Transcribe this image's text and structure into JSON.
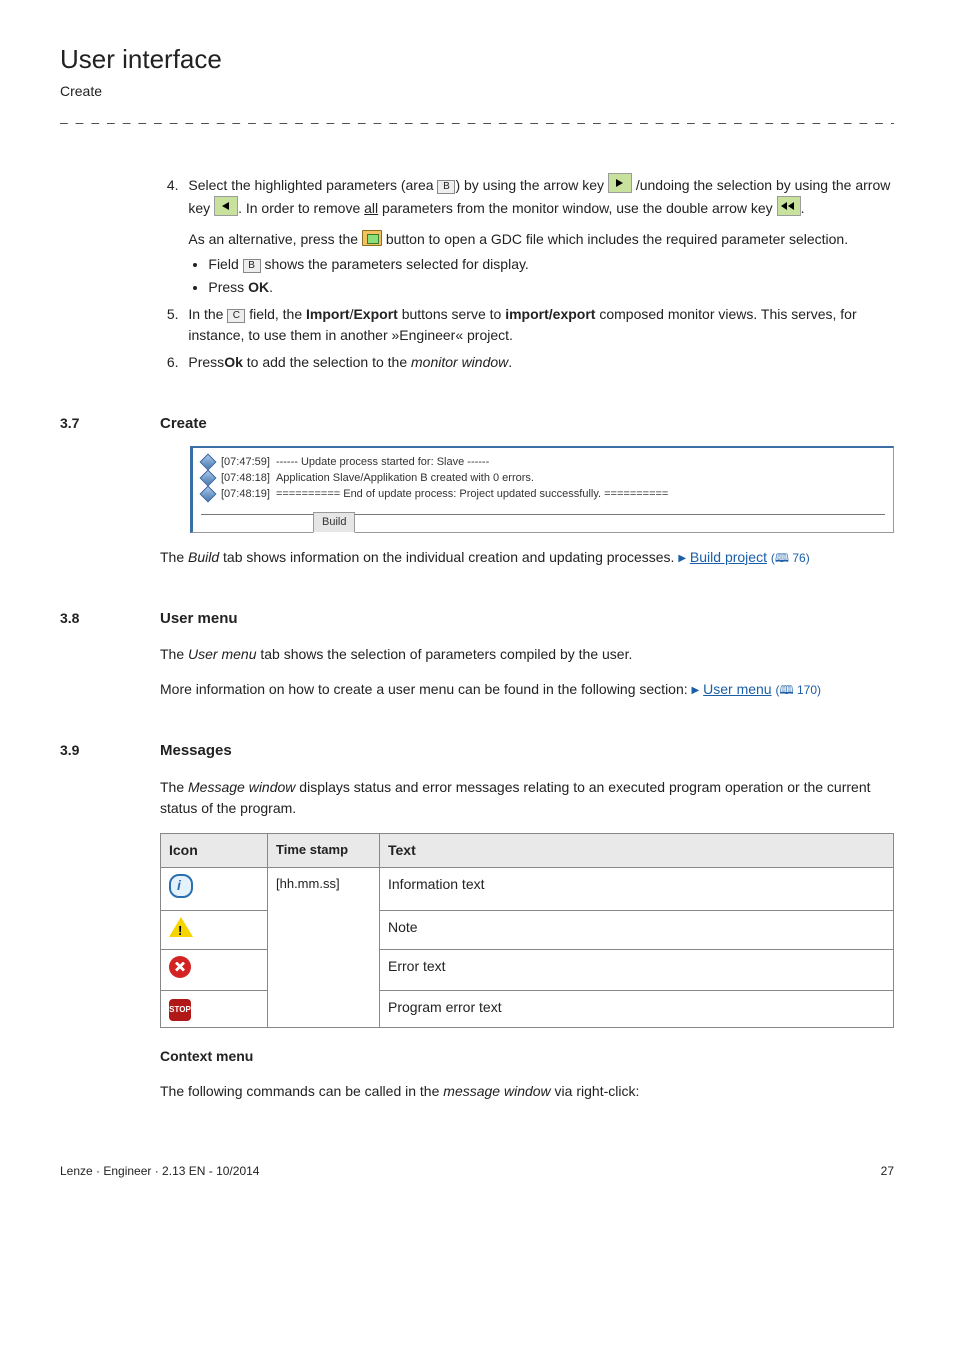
{
  "header": {
    "title": "User interface",
    "subtitle": "Create"
  },
  "steps": {
    "s4_a": "Select the highlighted parameters (area ",
    "s4_area_letter": "B",
    "s4_b": ") by using the arrow key ",
    "s4_c": " /undoing the selection by using the arrow key ",
    "s4_d": ". In order to remove ",
    "s4_all": "all",
    "s4_e": " parameters from the monitor window, use the double arrow key ",
    "s4_f": ".",
    "s4_alt_a": "As an alternative, press the ",
    "s4_alt_b": " button to open a GDC file which includes the required parameter selection.",
    "s4_bullet1_a": "Field ",
    "s4_bullet1_letter": "B",
    "s4_bullet1_b": " shows the parameters selected for display.",
    "s4_bullet2_a": "Press ",
    "s4_bullet2_ok": "OK",
    "s4_bullet2_b": ".",
    "s5_a": "In the ",
    "s5_letter": "C",
    "s5_b": " field, the ",
    "s5_import": "Import",
    "s5_slash": "/",
    "s5_export": "Export",
    "s5_c": " buttons serve to ",
    "s5_impexp": "import/export",
    "s5_d": " composed monitor views. This serves, for instance, to use them in another »Engineer« project.",
    "s6_a": "Press",
    "s6_ok": "Ok",
    "s6_b": " to add the selection to the ",
    "s6_mw": "monitor window",
    "s6_c": "."
  },
  "sec37": {
    "num": "3.7",
    "title": "Create"
  },
  "log": {
    "rows": [
      {
        "ts": "[07:47:59]",
        "txt": "------ Update process started for: Slave ------"
      },
      {
        "ts": "[07:48:18]",
        "txt": "Application Slave/Applikation B created with 0 errors."
      },
      {
        "ts": "[07:48:19]",
        "txt": "========== End of update process: Project updated successfully. =========="
      }
    ],
    "tab": "Build"
  },
  "buildline": {
    "a": "The ",
    "build": "Build",
    "b": " tab shows information on the individual creation and updating processes.  ",
    "link": "Build project",
    "ref": "76"
  },
  "sec38": {
    "num": "3.8",
    "title": "User menu",
    "line1_a": "The ",
    "line1_um": "User menu",
    "line1_b": " tab shows the selection of parameters compiled by the user.",
    "line2_a": "More information on how to create a user menu can be found in the following section:  ",
    "link": "User menu",
    "ref": "170"
  },
  "sec39": {
    "num": "3.9",
    "title": "Messages",
    "intro_a": "The ",
    "intro_mw": "Message window",
    "intro_b": " displays status and error messages relating to an executed program operation or the current status of the program."
  },
  "msgtable": {
    "h_icon": "Icon",
    "h_ts": "Time stamp",
    "h_txt": "Text",
    "ts_val": "[hh.mm.ss]",
    "r1": "Information text",
    "r2": "Note",
    "r3": "Error text",
    "r4": "Program error text"
  },
  "ctx": {
    "heading": "Context menu",
    "line_a": "The following commands can be called in the ",
    "line_mw": "message window",
    "line_b": " via right-click:"
  },
  "footer": {
    "left": "Lenze · Engineer · 2.13 EN - 10/2014",
    "right": "27"
  },
  "stop_label": "STOP"
}
